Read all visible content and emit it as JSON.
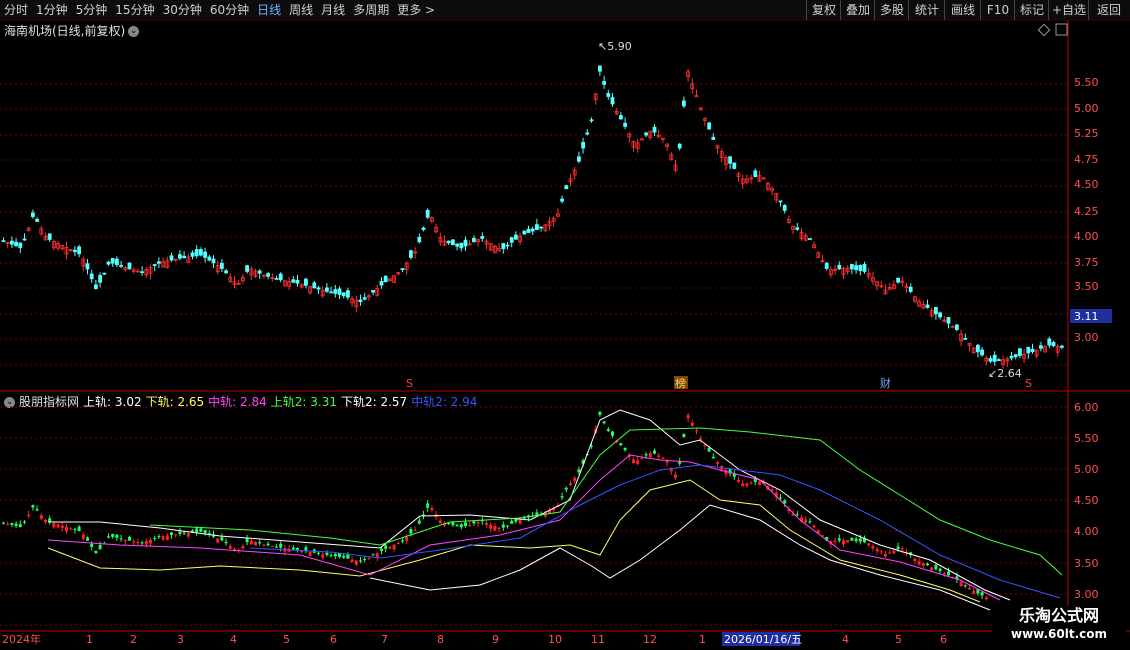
{
  "toolbar": {
    "periods": [
      "分时",
      "1分钟",
      "5分钟",
      "15分钟",
      "30分钟",
      "60分钟",
      "日线",
      "周线",
      "月线",
      "多周期",
      "更多 >"
    ],
    "active": "日线",
    "right_buttons": [
      "复权",
      "叠加",
      "多股",
      "统计",
      "画线",
      "F10",
      "标记",
      "+自选",
      "返回"
    ]
  },
  "main": {
    "title": "海南机场(日线,前复权)",
    "high_label": "5.90",
    "low_label": "2.64",
    "last_price": "3.11",
    "y_ticks": [
      "5.50",
      "5.25",
      "5.00",
      "4.75",
      "4.50",
      "4.25",
      "4.00",
      "3.75",
      "3.50",
      "3.00"
    ],
    "markers": [
      "S",
      "榜",
      "财",
      "S"
    ]
  },
  "indicator": {
    "name": "股朋指标网",
    "items": [
      {
        "label": "上轨: 3.02",
        "color": "#ffffff"
      },
      {
        "label": "下轨: 2.65",
        "color": "#ffff66"
      },
      {
        "label": "中轨: 2.84",
        "color": "#ff44ff"
      },
      {
        "label": "上轨2: 3.31",
        "color": "#44ff44"
      },
      {
        "label": "下轨2: 2.57",
        "color": "#ffffff"
      },
      {
        "label": "中轨2: 2.94",
        "color": "#3355ff"
      }
    ],
    "y_ticks": [
      "6.00",
      "5.50",
      "5.00",
      "4.50",
      "4.00",
      "3.50",
      "3.00"
    ]
  },
  "time_axis": {
    "labels": [
      "2024年",
      "1",
      "2",
      "3",
      "4",
      "5",
      "6",
      "7",
      "8",
      "9",
      "10",
      "11",
      "12",
      "1",
      "2026/01/16/五",
      "4",
      "5",
      "6"
    ]
  },
  "watermark": {
    "line1": "乐淘公式网",
    "line2": "www.60lt.com"
  },
  "colors": {
    "up": "#ff3030",
    "down": "#54ffff",
    "grid": "#7a0000",
    "axis": "#a00000"
  }
}
